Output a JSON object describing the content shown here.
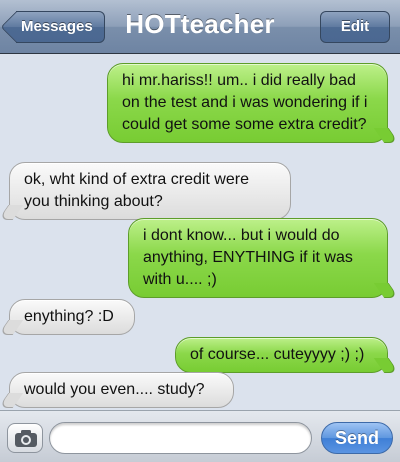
{
  "navbar": {
    "title": "HOTteacher",
    "back_label": "Messages",
    "edit_label": "Edit"
  },
  "messages": [
    {
      "direction": "sent",
      "text": "hi mr.hariss!! um.. i did really bad on the test and i was wondering if i could get some some extra credit?"
    },
    {
      "direction": "received",
      "text": "ok, wht kind of extra credit were you thinking about?"
    },
    {
      "direction": "sent",
      "text": "i dont know... but i would do anything, ENYTHING if it was with u.... ;)"
    },
    {
      "direction": "received",
      "text": "enything? :D"
    },
    {
      "direction": "sent",
      "text": "of course... cuteyyyy ;) ;)"
    },
    {
      "direction": "received",
      "text": "would you even.... study?"
    }
  ],
  "composer": {
    "input_value": "",
    "send_label": "Send",
    "camera_icon": "camera-icon"
  },
  "colors": {
    "sent_bubble": "#8bd84a",
    "received_bubble": "#e8e8e8",
    "background": "#dbe2ed",
    "send_button": "#3f7fd6"
  }
}
